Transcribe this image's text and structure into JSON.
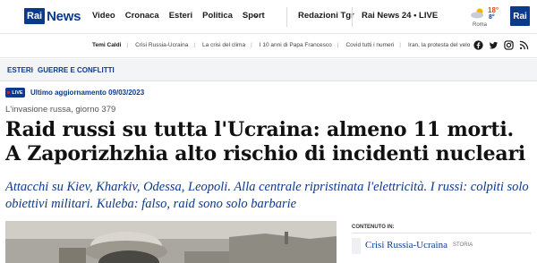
{
  "header": {
    "logo_box": "Rai",
    "logo_word": "News",
    "nav": [
      "Video",
      "Cronaca",
      "Esteri",
      "Politica",
      "Sport"
    ],
    "right_links": [
      "Redazioni Tgr",
      "Rai News 24 • LIVE"
    ],
    "weather": {
      "high": "18°",
      "low": "8°",
      "city": "Roma"
    },
    "brand_badge": "Rai"
  },
  "strip": {
    "tags": [
      "Temi Caldi",
      "Crisi Russia-Ucraina",
      "La crisi del clima",
      "I 10 anni di Papa Francesco",
      "Covid tutti i numeri",
      "Iran, la protesta del velo"
    ],
    "social_icons": [
      "facebook-icon",
      "twitter-icon",
      "instagram-icon",
      "rss-icon"
    ]
  },
  "breadcrumb": {
    "section": "ESTERI",
    "subsection": "GUERRE E CONFLITTI"
  },
  "article": {
    "live_badge": "LIVE",
    "updated": "Ultimo aggiornamento 09/03/2023",
    "kicker": "L'invasione russa, giorno 379",
    "title": "Raid russi su tutta l'Ucraina: almeno 11 morti. A Zaporizhzhia alto rischio di incidenti nucleari",
    "summary": "Attacchi su Kiev, Kharkiv, Odessa, Leopoli. Alla centrale ripristinata l'elettricità. I russi: colpiti solo obiettivi militari. Kuleba: falso, raid sono solo barbarie"
  },
  "sidebar": {
    "label": "CONTENUTO IN:",
    "topic": "Crisi Russia-Ucraina",
    "topic_type": "STORIA"
  },
  "colors": {
    "brand": "#0b3a8c",
    "live_dot": "#e0211b"
  }
}
